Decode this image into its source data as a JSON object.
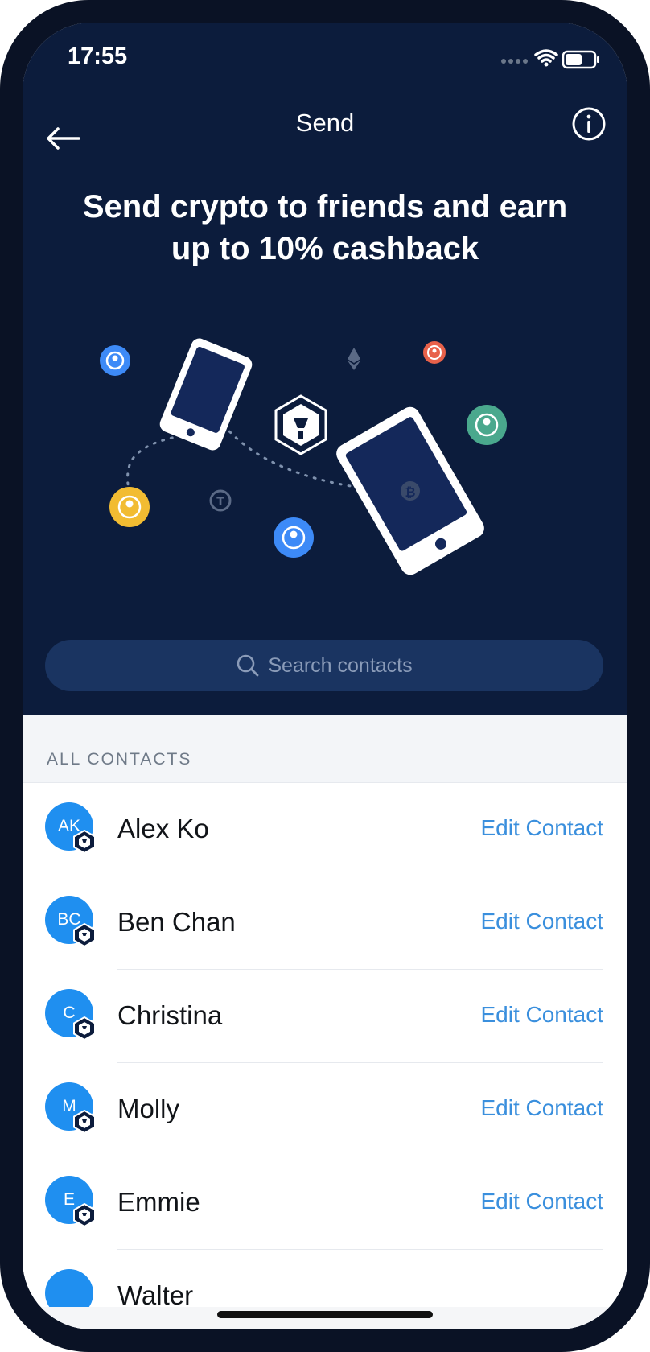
{
  "status": {
    "time": "17:55"
  },
  "header": {
    "title": "Send"
  },
  "hero": {
    "headline_line1": "Send crypto to friends and earn",
    "headline_line2": "up to 10% cashback"
  },
  "search": {
    "placeholder": "Search contacts"
  },
  "contacts": {
    "section_label": "ALL CONTACTS",
    "edit_label": "Edit Contact",
    "items": [
      {
        "initials": "AK",
        "name": "Alex Ko"
      },
      {
        "initials": "BC",
        "name": "Ben Chan"
      },
      {
        "initials": "C",
        "name": "Christina"
      },
      {
        "initials": "M",
        "name": "Molly"
      },
      {
        "initials": "E",
        "name": "Emmie"
      },
      {
        "initials": "",
        "name": "Walter"
      }
    ]
  },
  "colors": {
    "hero_bg": "#0c1c3c",
    "accent_blue": "#1f8ff0",
    "link_blue": "#3a8fdd",
    "search_bg": "#1a3461"
  },
  "icons": {
    "back": "arrow-left-icon",
    "info": "info-icon",
    "search": "search-icon",
    "badge": "cro-logo-icon"
  }
}
